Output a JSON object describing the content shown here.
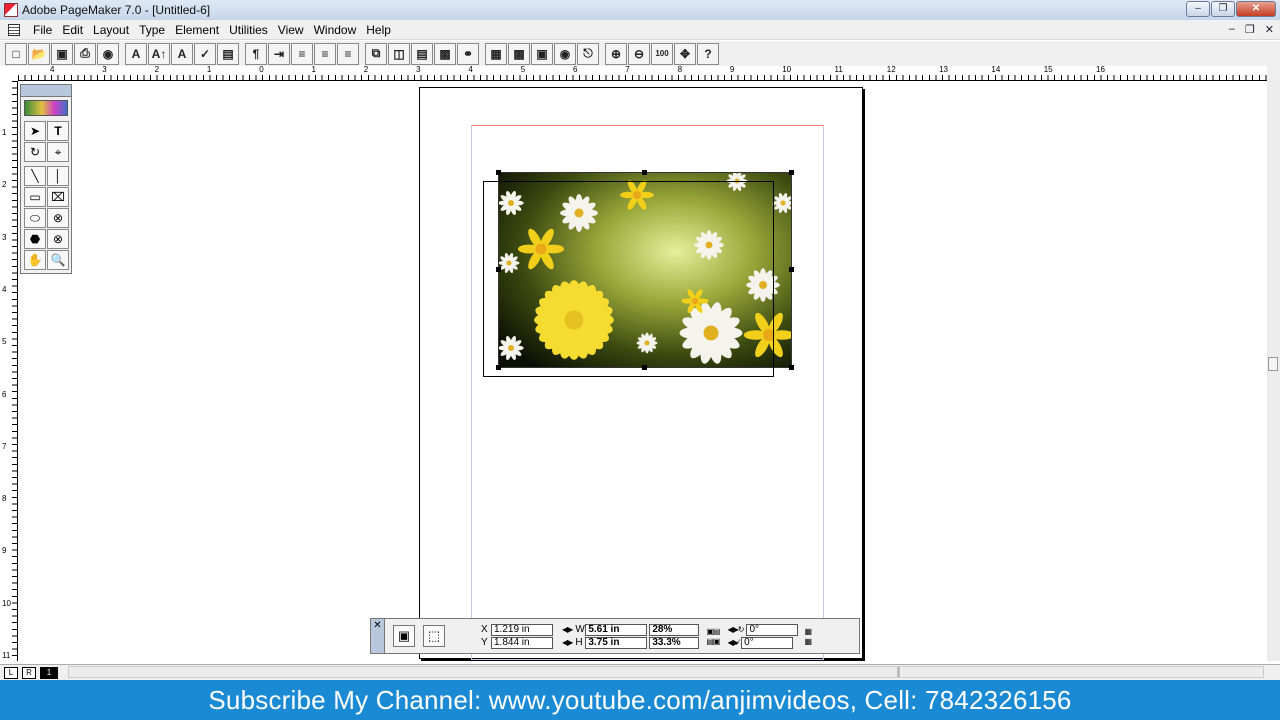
{
  "window": {
    "title": "Adobe PageMaker 7.0 - [Untitled-6]"
  },
  "menu": {
    "items": [
      "File",
      "Edit",
      "Layout",
      "Type",
      "Element",
      "Utilities",
      "View",
      "Window",
      "Help"
    ]
  },
  "toolbar": {
    "icons": [
      "new-icon",
      "open-icon",
      "save-icon",
      "print-icon",
      "find-icon",
      "font-icon",
      "font-size-icon",
      "font-small-icon",
      "spell-check-icon",
      "frame-icon",
      "paragraph-icon",
      "indent-icon",
      "bullets-icon",
      "align-left-icon",
      "align-icon",
      "copy-icon",
      "paste-icon",
      "story-editor-icon",
      "image-icon",
      "link-icon",
      "place-icon",
      "color-image-icon",
      "photo-icon",
      "globe-icon",
      "pdf-icon",
      "zoom-in-icon",
      "zoom-out-icon",
      "actual-size-icon",
      "fit-page-icon",
      "help-icon"
    ]
  },
  "ruler": {
    "h_labels": [
      "4",
      "3",
      "2",
      "1",
      "0",
      "1",
      "2",
      "3",
      "4",
      "5",
      "6",
      "7",
      "8",
      "9",
      "10",
      "11",
      "12",
      "13",
      "14",
      "15",
      "16"
    ],
    "v_labels": [
      "1",
      "2",
      "3",
      "4",
      "5",
      "6",
      "7",
      "8",
      "9",
      "10",
      "11"
    ]
  },
  "toolbox": {
    "tools": [
      "pointer-tool",
      "text-tool",
      "rotate-tool",
      "crop-tool",
      "line-tool",
      "constrained-line-tool",
      "rectangle-tool",
      "rectangle-frame-tool",
      "ellipse-tool",
      "ellipse-frame-tool",
      "polygon-tool",
      "polygon-frame-tool",
      "hand-tool",
      "zoom-tool"
    ]
  },
  "control_palette": {
    "x_label": "X",
    "x_value": "1.219 in",
    "y_label": "Y",
    "y_value": "1.844 in",
    "w_label": "W",
    "w_value": "5.61 in",
    "h_label": "H",
    "h_value": "3.75 in",
    "w_percent": "28%",
    "h_percent": "33.3%",
    "rotation": "0°",
    "skew": "0°"
  },
  "pages": {
    "left": "L",
    "right": "R",
    "current": "1"
  },
  "banner": {
    "text": "Subscribe My Channel: www.youtube.com/anjimvideos, Cell: 7842326156"
  }
}
